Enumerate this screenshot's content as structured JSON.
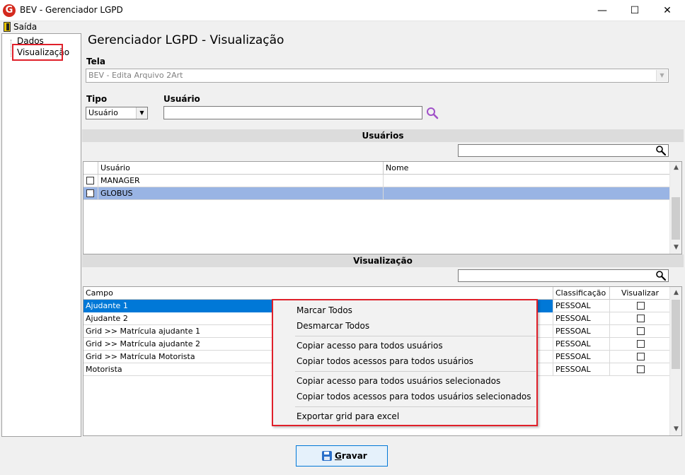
{
  "window": {
    "title": "BEV - Gerenciador LGPD",
    "app_icon_letter": "G",
    "minimize": "—",
    "maximize": "☐",
    "close": "✕"
  },
  "menu": {
    "exit_label": "Saída"
  },
  "tree": {
    "items": [
      "Dados",
      "Visualização"
    ]
  },
  "page_title": "Gerenciador LGPD - Visualização",
  "tela": {
    "label": "Tela",
    "value": "BEV - Edita Arquivo 2Art"
  },
  "tipo": {
    "label": "Tipo",
    "value": "Usuário"
  },
  "usuario": {
    "label": "Usuário",
    "value": ""
  },
  "usuarios_section": {
    "title": "Usuários",
    "search_value": "",
    "columns": [
      "Usuário",
      "Nome"
    ],
    "rows": [
      {
        "checked": false,
        "usuario": "MANAGER",
        "nome": ""
      },
      {
        "checked": true,
        "usuario": "GLOBUS",
        "nome": ""
      }
    ]
  },
  "visualizacao_section": {
    "title": "Visualização",
    "search_value": "",
    "columns": [
      "Campo",
      "Classificação",
      "Visualizar"
    ],
    "rows": [
      {
        "campo": "Ajudante 1",
        "classificacao": "PESSOAL",
        "visualizar": false
      },
      {
        "campo": "Ajudante 2",
        "classificacao": "PESSOAL",
        "visualizar": false
      },
      {
        "campo": "Grid >> Matrícula ajudante 1",
        "classificacao": "PESSOAL",
        "visualizar": false
      },
      {
        "campo": "Grid >> Matrícula ajudante 2",
        "classificacao": "PESSOAL",
        "visualizar": false
      },
      {
        "campo": "Grid >> Matrícula Motorista",
        "classificacao": "PESSOAL",
        "visualizar": false
      },
      {
        "campo": "Motorista",
        "classificacao": "PESSOAL",
        "visualizar": false
      }
    ]
  },
  "context_menu": {
    "items": [
      "Marcar Todos",
      "Desmarcar Todos",
      "Copiar acesso para todos usuários",
      "Copiar todos acessos para todos usuários",
      "Copiar acesso para todos usuários selecionados",
      "Copiar todos acessos para todos usuários selecionados",
      "Exportar grid para excel"
    ]
  },
  "save_button": {
    "label": "Gravar",
    "accel": "G",
    "rest": "ravar"
  },
  "colors": {
    "selected_row_blue": "#0078d7",
    "selected_row_light": "#99b4e4",
    "highlight_red": "#e0202a",
    "search_icon_purple": "#a050c8"
  },
  "icons": {
    "search": "magnifier-icon",
    "save": "floppy-disk-icon",
    "exit": "door-icon",
    "dropdown": "chevron-down-icon"
  }
}
